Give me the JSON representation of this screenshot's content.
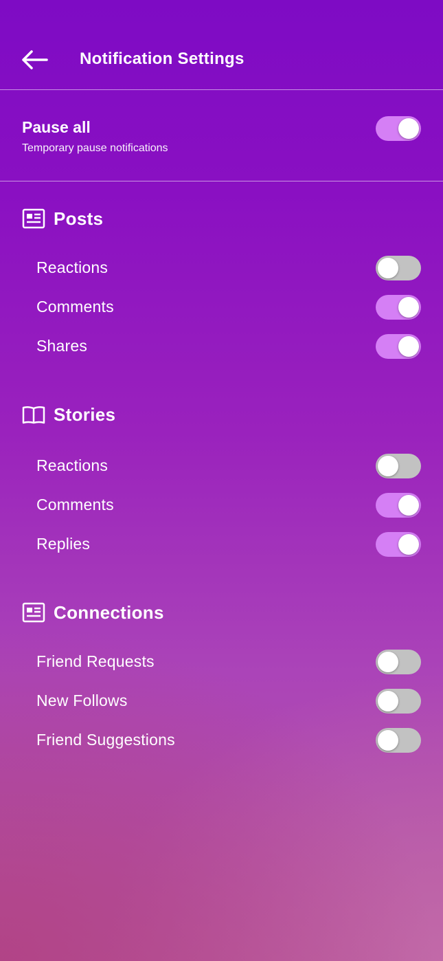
{
  "header": {
    "title": "Notification Settings",
    "back_icon": "arrow-left-icon"
  },
  "pause": {
    "label": "Pause all",
    "sublabel": "Temporary pause notifications",
    "enabled": true
  },
  "colors": {
    "toggle_on": "#d57ff5",
    "toggle_off": "#c2c2c2",
    "divider": "#ffffff"
  },
  "sections": [
    {
      "title": "Posts",
      "icon": "newspaper-icon",
      "items": [
        {
          "label": "Reactions",
          "enabled": false
        },
        {
          "label": "Comments",
          "enabled": true
        },
        {
          "label": "Shares",
          "enabled": true
        }
      ]
    },
    {
      "title": "Stories",
      "icon": "book-open-icon",
      "items": [
        {
          "label": "Reactions",
          "enabled": false
        },
        {
          "label": "Comments",
          "enabled": true
        },
        {
          "label": "Replies",
          "enabled": true
        }
      ]
    },
    {
      "title": "Connections",
      "icon": "newspaper-icon",
      "items": [
        {
          "label": "Friend Requests",
          "enabled": false
        },
        {
          "label": "New Follows",
          "enabled": false
        },
        {
          "label": "Friend Suggestions",
          "enabled": false
        }
      ]
    }
  ]
}
